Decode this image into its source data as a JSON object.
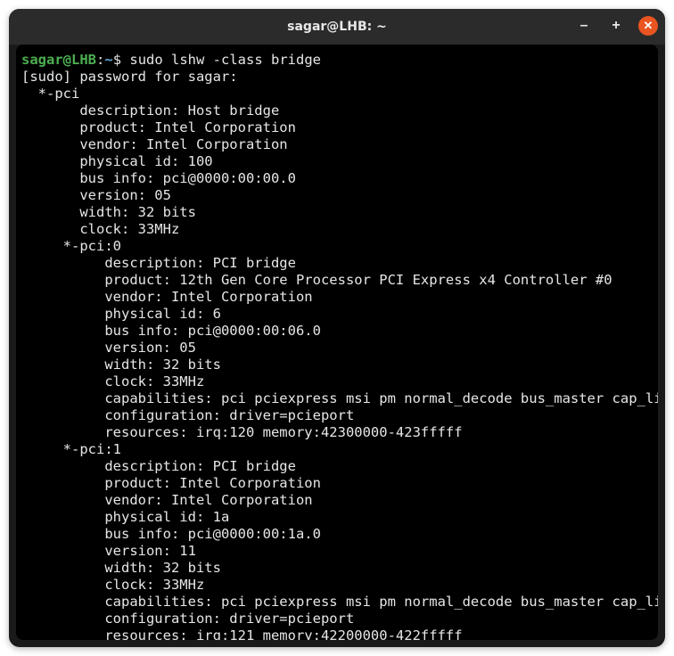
{
  "window": {
    "title": "sagar@LHB: ~"
  },
  "prompt": {
    "user_host": "sagar@LHB",
    "sep1": ":",
    "path": "~",
    "dollar": "$ ",
    "command": "sudo lshw -class bridge"
  },
  "output": {
    "sudo_line": "[sudo] password for sagar:",
    "devices": [
      {
        "header": "  *-pci",
        "indent": "       ",
        "fields": [
          "description: Host bridge",
          "product: Intel Corporation",
          "vendor: Intel Corporation",
          "physical id: 100",
          "bus info: pci@0000:00:00.0",
          "version: 05",
          "width: 32 bits",
          "clock: 33MHz"
        ]
      },
      {
        "header": "     *-pci:0",
        "indent": "          ",
        "fields": [
          "description: PCI bridge",
          "product: 12th Gen Core Processor PCI Express x4 Controller #0",
          "vendor: Intel Corporation",
          "physical id: 6",
          "bus info: pci@0000:00:06.0",
          "version: 05",
          "width: 32 bits",
          "clock: 33MHz",
          "capabilities: pci pciexpress msi pm normal_decode bus_master cap_list",
          "configuration: driver=pcieport",
          "resources: irq:120 memory:42300000-423fffff"
        ]
      },
      {
        "header": "     *-pci:1",
        "indent": "          ",
        "fields": [
          "description: PCI bridge",
          "product: Intel Corporation",
          "vendor: Intel Corporation",
          "physical id: 1a",
          "bus info: pci@0000:00:1a.0",
          "version: 11",
          "width: 32 bits",
          "clock: 33MHz",
          "capabilities: pci pciexpress msi pm normal_decode bus_master cap_list",
          "configuration: driver=pcieport",
          "resources: irq:121 memory:42200000-422fffff"
        ]
      }
    ]
  }
}
